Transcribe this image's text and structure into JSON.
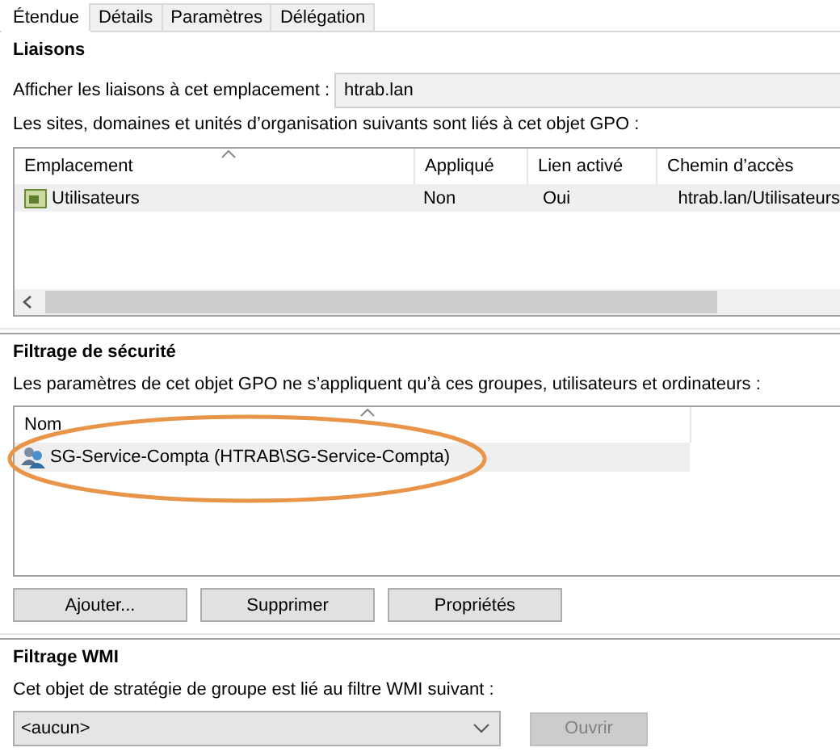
{
  "tabs": [
    {
      "label": "Étendue",
      "selected": true
    },
    {
      "label": "Détails",
      "selected": false
    },
    {
      "label": "Paramètres",
      "selected": false
    },
    {
      "label": "Délégation",
      "selected": false
    }
  ],
  "links": {
    "title": "Liaisons",
    "location_label": "Afficher les liaisons à cet emplacement :",
    "location_value": "htrab.lan",
    "description": "Les sites, domaines et unités d’organisation suivants sont liés à cet objet GPO :",
    "table": {
      "columns": [
        "Emplacement",
        "Appliqué",
        "Lien activé",
        "Chemin d’accès"
      ],
      "rows": [
        {
          "cells": [
            "Utilisateurs",
            "Non",
            "Oui",
            "htrab.lan/Utilisateurs"
          ],
          "selected": true
        }
      ]
    }
  },
  "security_filtering": {
    "title": "Filtrage de sécurité",
    "description": "Les paramètres de cet objet GPO ne s’appliquent qu’à ces groupes, utilisateurs et ordinateurs :",
    "column": "Nom",
    "items": [
      {
        "label": "SG-Service-Compta (HTRAB\\SG-Service-Compta)",
        "selected": true,
        "highlighted": true
      }
    ],
    "buttons": [
      {
        "label": "Ajouter...",
        "disabled": false
      },
      {
        "label": "Supprimer",
        "disabled": false
      },
      {
        "label": "Propriétés",
        "disabled": false
      }
    ]
  },
  "wmi_filtering": {
    "title": "Filtrage WMI",
    "description": "Cet objet de stratégie de groupe est lié au filtre WMI suivant :",
    "value": "<aucun>",
    "button": {
      "label": "Ouvrir",
      "disabled": true
    }
  }
}
